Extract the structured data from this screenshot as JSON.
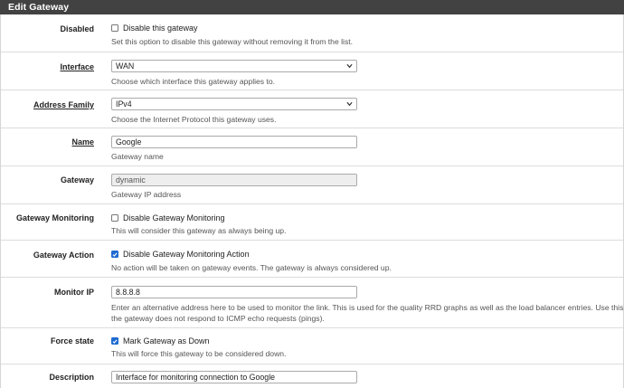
{
  "panel": {
    "title": "Edit Gateway"
  },
  "rows": {
    "disabled": {
      "label": "Disabled",
      "checkbox_label": "Disable this gateway",
      "checked": false,
      "help": "Set this option to disable this gateway without removing it from the list."
    },
    "interface": {
      "label": "Interface",
      "value": "WAN",
      "help": "Choose which interface this gateway applies to."
    },
    "address_family": {
      "label": "Address Family",
      "value": "IPv4",
      "help": "Choose the Internet Protocol this gateway uses."
    },
    "name": {
      "label": "Name",
      "value": "Google",
      "help": "Gateway name"
    },
    "gateway": {
      "label": "Gateway",
      "value": "dynamic",
      "help": "Gateway IP address"
    },
    "gateway_monitoring": {
      "label": "Gateway Monitoring",
      "checkbox_label": "Disable Gateway Monitoring",
      "checked": false,
      "help": "This will consider this gateway as always being up."
    },
    "gateway_action": {
      "label": "Gateway Action",
      "checkbox_label": "Disable Gateway Monitoring Action",
      "checked": true,
      "help": "No action will be taken on gateway events. The gateway is always considered up."
    },
    "monitor_ip": {
      "label": "Monitor IP",
      "value": "8.8.8.8",
      "help_line1": "Enter an alternative address here to be used to monitor the link. This is used for the quality RRD graphs as well as the load balancer entries. Use this if",
      "help_line2": "the gateway does not respond to ICMP echo requests (pings)."
    },
    "force_state": {
      "label": "Force state",
      "checkbox_label": "Mark Gateway as Down",
      "checked": true,
      "help": "This will force this gateway to be considered down."
    },
    "description": {
      "label": "Description",
      "value": "Interface for monitoring connection to Google"
    }
  },
  "colors": {
    "header_bg": "#424242",
    "checkbox_checked": "#1e6ad1",
    "border": "#dcdcdc"
  },
  "icons": {
    "checkbox_checked": "check-icon",
    "select_arrow": "chevron-down-icon"
  }
}
